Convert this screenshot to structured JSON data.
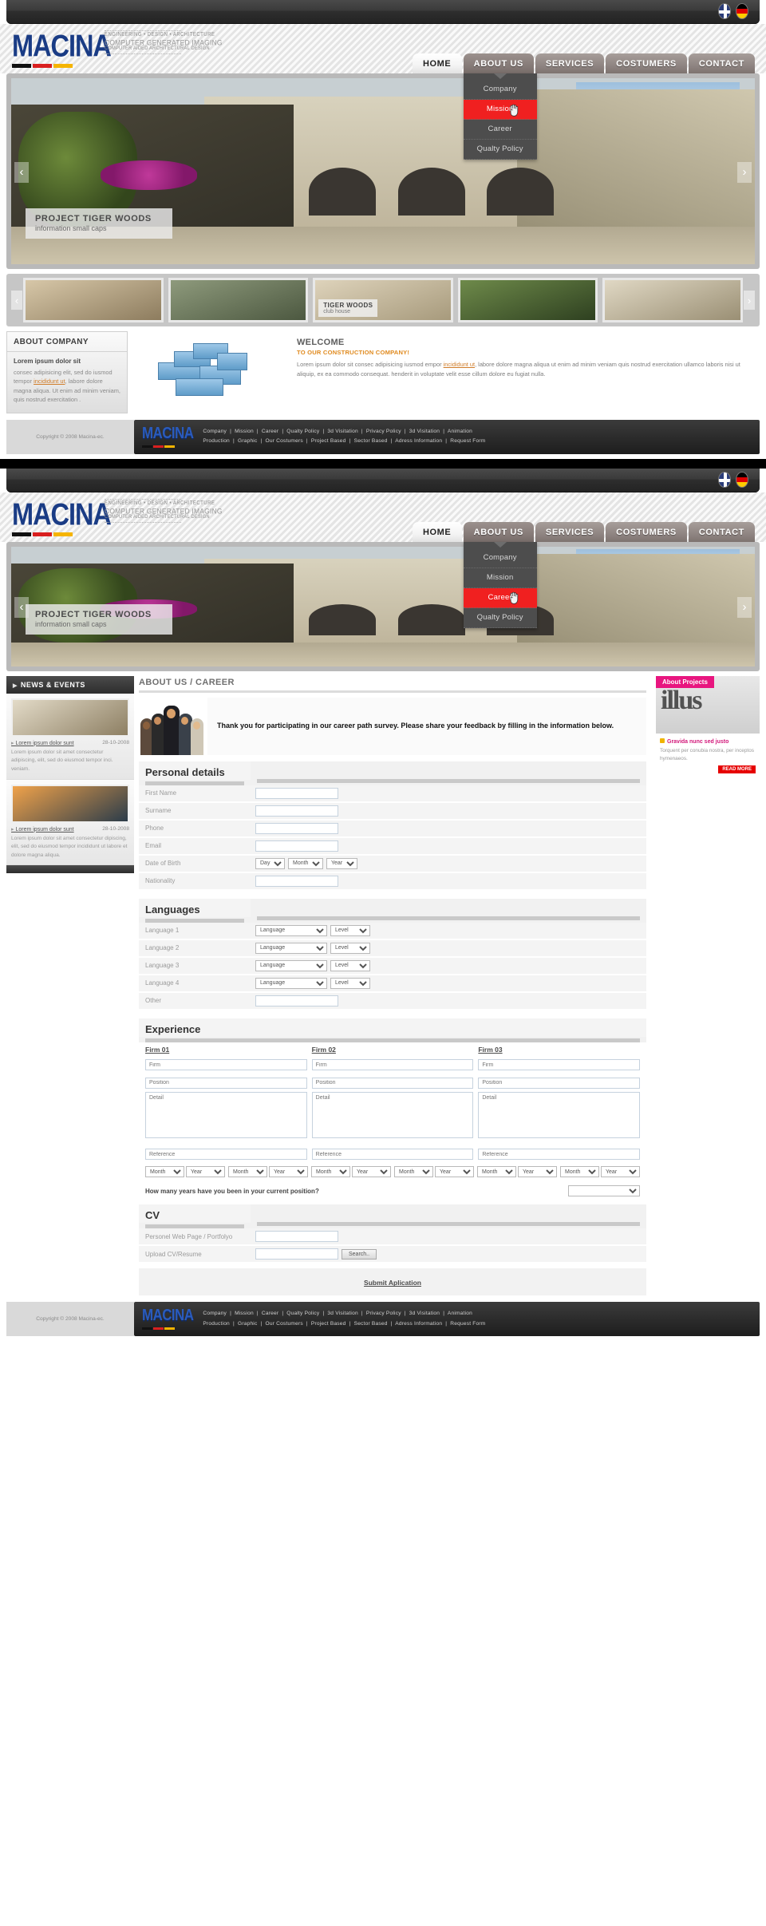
{
  "brand": {
    "name": "MACINA",
    "tagline_1": "ENGINEERING • DESIGN • ARCHITECTURE",
    "tagline_2": "COMPUTER GENERATED IMAGING",
    "tagline_3": "COMPUTER AIDED ARCHITECTURAL DESIGN",
    "colors": {
      "logo_blue": "#1a3c85",
      "accent_red": "#f02020",
      "accent_pink": "#e8167f",
      "accent_orange": "#e08a1e"
    }
  },
  "topbar": {
    "flags": [
      {
        "name": "english",
        "label": "EN"
      },
      {
        "name": "german",
        "label": "DE"
      }
    ]
  },
  "nav": {
    "items": [
      {
        "label": "HOME",
        "state": "home"
      },
      {
        "label": "ABOUT US",
        "state": "active"
      },
      {
        "label": "SERVICES",
        "state": "normal"
      },
      {
        "label": "COSTUMERS",
        "state": "normal"
      },
      {
        "label": "CONTACT",
        "state": "normal"
      }
    ],
    "dropdown": [
      {
        "label": "Company",
        "highlighted": false
      },
      {
        "label": "Mission",
        "highlighted": true
      },
      {
        "label": "Career",
        "highlighted": false
      },
      {
        "label": "Qualty Policy",
        "highlighted": false
      }
    ],
    "dropdown_2": [
      {
        "label": "Company",
        "highlighted": false
      },
      {
        "label": "Mission",
        "highlighted": false
      },
      {
        "label": "Career",
        "highlighted": true
      },
      {
        "label": "Qualty Policy",
        "highlighted": false
      }
    ]
  },
  "slider": {
    "caption_title": "PROJECT TIGER WOODS",
    "caption_sub": "information small caps",
    "prev": "‹",
    "next": "›"
  },
  "thumbs": {
    "prev": "‹",
    "next": "›",
    "items": [
      {
        "title": "",
        "sub": "",
        "style": "t-a"
      },
      {
        "title": "",
        "sub": "",
        "style": "t-b"
      },
      {
        "title": "TIGER WOODS",
        "sub": "club house",
        "style": "t-c"
      },
      {
        "title": "",
        "sub": "",
        "style": "t-d"
      },
      {
        "title": "",
        "sub": "",
        "style": "t-e"
      }
    ]
  },
  "about_company": {
    "heading": "ABOUT COMPANY",
    "lead": "Lorem ipsum dolor sit",
    "body_1": "consec adipisicing elit, sed do iusmod tempor ",
    "link": "incididunt ut",
    "body_2": ", labore dolore magna aliqua. Ut enim ad minim veniam, quis nostrud exercitation ."
  },
  "welcome": {
    "heading": "WELCOME",
    "sub": "TO OUR CONSTRUCTION COMPANY!",
    "body_1": "Lorem ipsum dolor sit consec adipisicing iusmod empor ",
    "link": "incididunt ut",
    "body_2": ", labore dolore magna aliqua ut enim ad minim veniam quis nostrud exercitation ullamco laboris nisi ut aliquip, ex ea commodo consequat. henderit in voluptate velit esse cillum dolore eu fugiat nulla."
  },
  "footer": {
    "copyright": "Copyright © 2008 Macina-ec.",
    "logo": "MACINA",
    "links_row_1": [
      "Company",
      "Mission",
      "Career",
      "Qualty Policy",
      "3d Visitation",
      "Privacy Policy",
      "3d Visitation",
      "Animation"
    ],
    "links_row_2": [
      "Production",
      "Graphic",
      "Our Costumers",
      "Project Based",
      "Sector Based",
      "Adress Information",
      "Request Form"
    ]
  },
  "sidebar": {
    "heading": "NEWS & EVENTS",
    "arrow": "▶",
    "items": [
      {
        "title": "Lorem ipsum dolor sunt",
        "date": "28-10-2008",
        "text": "Lorem ipsum dolor sit amet consectetur adipiscing, elit, sed do eiusmod tempor inci. veniam.",
        "thumb": "nt-1"
      },
      {
        "title": "Lorem ipsum dolor sunt",
        "date": "28-10-2008",
        "text": "Lorem ipsum dolor sit amet consectetur dipiscing, elit, sed do eiusmod tempor incididunt ut labore et dolore magna aliqua.",
        "thumb": "nt-2"
      }
    ]
  },
  "main": {
    "breadcrumb": "ABOUT US / CAREER",
    "intro_text": "Thank you for participating in our career path survey. Please share your feedback by filling in the information below."
  },
  "aside": {
    "tag": "About Projects",
    "word": "illus",
    "news_title": "Gravida nunc sed justo",
    "news_text": "Torquent per conubia nostra, per inceptos hymenaeos.",
    "read_more": "READ MORE"
  },
  "form": {
    "personal": {
      "title": "Personal details",
      "rows": [
        {
          "label": "First Name",
          "type": "text",
          "value": ""
        },
        {
          "label": "Surname",
          "type": "text",
          "value": ""
        },
        {
          "label": "Phone",
          "type": "text",
          "value": ""
        },
        {
          "label": "Email",
          "type": "text",
          "value": ""
        },
        {
          "label": "Date of Birth",
          "type": "dob",
          "day": "Day",
          "month": "Month",
          "year": "Year"
        },
        {
          "label": "Nationality",
          "type": "text",
          "value": ""
        }
      ]
    },
    "languages": {
      "title": "Languages",
      "rows": [
        {
          "label": "Language 1",
          "lang": "Language",
          "level": "Level"
        },
        {
          "label": "Language 2",
          "lang": "Language",
          "level": "Level"
        },
        {
          "label": "Language 3",
          "lang": "Language",
          "level": "Level"
        },
        {
          "label": "Language 4",
          "lang": "Language",
          "level": "Level"
        },
        {
          "label": "Other",
          "lang": "",
          "level": ""
        }
      ]
    },
    "experience": {
      "title": "Experience",
      "columns": [
        {
          "heading": "Firm 01",
          "firm": "Firm",
          "position": "Position",
          "detail": "Detail",
          "reference": "Reference"
        },
        {
          "heading": "Firm 02",
          "firm": "Firm",
          "position": "Position",
          "detail": "Detail",
          "reference": "Reference"
        },
        {
          "heading": "Firm 03",
          "firm": "Firm",
          "position": "Position",
          "detail": "Detail",
          "reference": "Reference"
        }
      ],
      "date_selects": [
        "Month",
        "Year",
        "Month",
        "Year",
        "Month",
        "Year",
        "Month",
        "Year",
        "Month",
        "Year",
        "Month",
        "Year"
      ],
      "question": "How many years have you been in your current position?",
      "question_value": ""
    },
    "cv": {
      "title": "CV",
      "portfolio_label": "Personel Web Page / Portfolyo",
      "upload_label": "Upload CV/Resume",
      "search_button": "Search..",
      "submit_label": "Submit Aplication"
    }
  }
}
